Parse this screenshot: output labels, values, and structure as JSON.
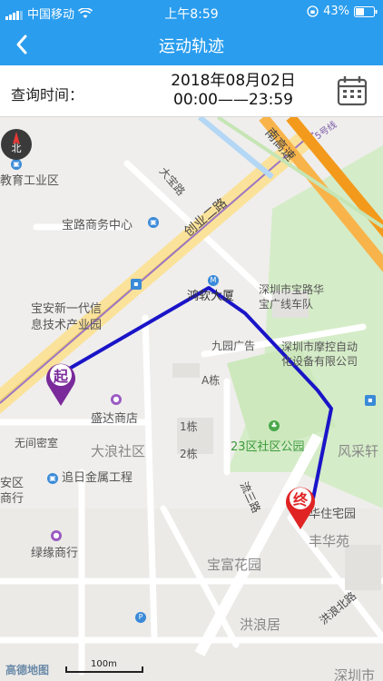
{
  "status_bar": {
    "carrier": "中国移动",
    "time": "上午8:59",
    "battery": "43%"
  },
  "nav": {
    "title": "运动轨迹"
  },
  "query": {
    "label": "查询时间：",
    "date": "2018年08月02日",
    "time_range": "00:00——23:59"
  },
  "map": {
    "labels": {
      "jiaoyu": "教育工业区",
      "baolu": "宝路商务中心",
      "baoan_l1": "宝安新一代信",
      "baoan_l2": "息技术产业园",
      "wuxian": "无间密室",
      "anqu": "安区",
      "shanghang": "商行",
      "shengda": "盛达商店",
      "dalang": "大浪社区",
      "zhuiri": "追日金属工程",
      "lvyuan": "绿缘商行",
      "dabao": "大宝路",
      "chuangye": "创业二路",
      "haoteng": "鸿软大厦",
      "jiuyuan": "九园广告",
      "a_dong": "A栋",
      "dong1": "1栋",
      "dong2": "2栋",
      "szbh1": "深圳市宝路华",
      "szbh2": "宝广线车队",
      "szmk1": "深圳市摩控自动",
      "szmk2": "化设备有限公司",
      "gongyuan": "23区社区公园",
      "fengcai": "风采轩",
      "zhuzhai": "华住宅园",
      "fenghua": "丰华苑",
      "baofu": "宝富花园",
      "hongjiang": "洪浪居",
      "hongbei": "洪浪北路",
      "liusan": "流三路",
      "gaosu": "南高速",
      "line5": "5号线",
      "shenzhen_bottom": "深圳市"
    },
    "start_marker": "起",
    "end_marker": "终",
    "compass": "北",
    "scale": "100m",
    "logo": "高德地图",
    "track_color": "#1a14c8"
  }
}
